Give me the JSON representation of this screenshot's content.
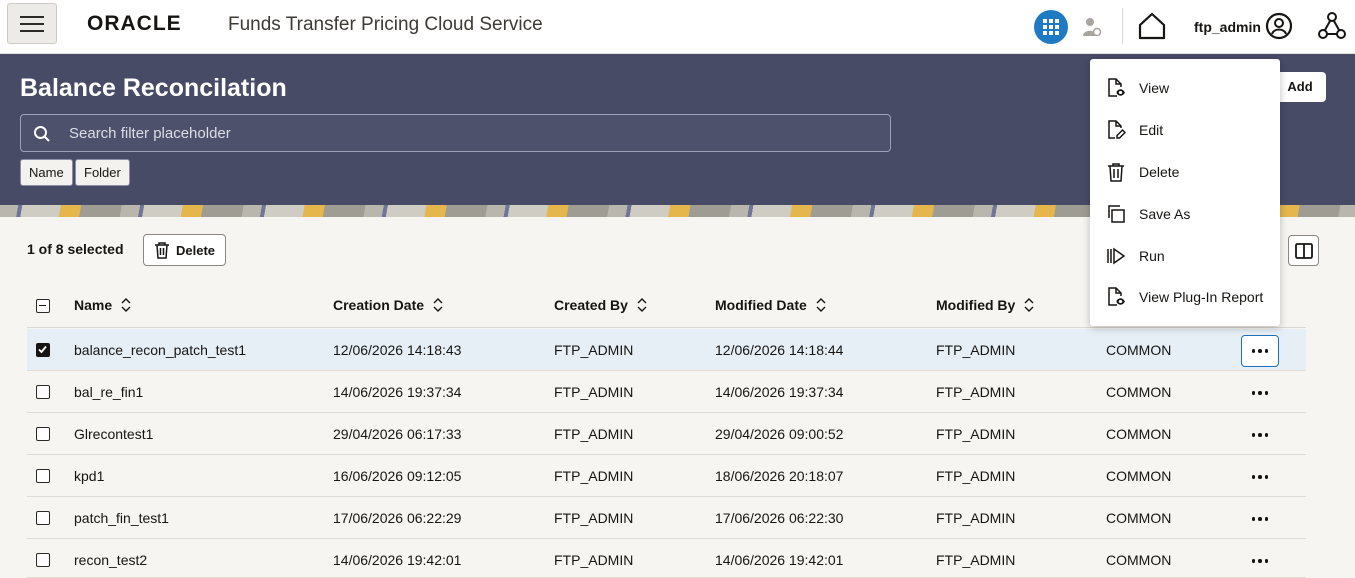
{
  "header": {
    "brand": "ORACLE",
    "app_title": "Funds Transfer Pricing Cloud Service",
    "user_name": "ftp_admin",
    "accent_color": "#1f7ac4"
  },
  "banner": {
    "title": "Balance Reconcilation",
    "search_placeholder": "Search filter placeholder",
    "filter_chips": [
      "Name",
      "Folder"
    ],
    "add_label": "Add"
  },
  "toolbar": {
    "selection_text": "1 of 8 selected",
    "delete_label": "Delete"
  },
  "table": {
    "columns": [
      "Name",
      "Creation Date",
      "Created By",
      "Modified Date",
      "Modified By"
    ],
    "rows": [
      {
        "name": "balance_recon_patch_test1",
        "created": "12/06/2026 14:18:43",
        "created_by": "FTP_ADMIN",
        "modified": "12/06/2026 14:18:44",
        "modified_by": "FTP_ADMIN",
        "folder": "COMMON",
        "selected": true
      },
      {
        "name": "bal_re_fin1",
        "created": "14/06/2026 19:37:34",
        "created_by": "FTP_ADMIN",
        "modified": "14/06/2026 19:37:34",
        "modified_by": "FTP_ADMIN",
        "folder": "COMMON",
        "selected": false
      },
      {
        "name": "Glrecontest1",
        "created": "29/04/2026 06:17:33",
        "created_by": "FTP_ADMIN",
        "modified": "29/04/2026 09:00:52",
        "modified_by": "FTP_ADMIN",
        "folder": "COMMON",
        "selected": false
      },
      {
        "name": "kpd1",
        "created": "16/06/2026 09:12:05",
        "created_by": "FTP_ADMIN",
        "modified": "18/06/2026 20:18:07",
        "modified_by": "FTP_ADMIN",
        "folder": "COMMON",
        "selected": false
      },
      {
        "name": "patch_fin_test1",
        "created": "17/06/2026 06:22:29",
        "created_by": "FTP_ADMIN",
        "modified": "17/06/2026 06:22:30",
        "modified_by": "FTP_ADMIN",
        "folder": "COMMON",
        "selected": false
      },
      {
        "name": "recon_test2",
        "created": "14/06/2026 19:42:01",
        "created_by": "FTP_ADMIN",
        "modified": "14/06/2026 19:42:01",
        "modified_by": "FTP_ADMIN",
        "folder": "COMMON",
        "selected": false
      }
    ]
  },
  "context_menu": {
    "items": [
      {
        "label": "View",
        "icon": "view-doc-icon"
      },
      {
        "label": "Edit",
        "icon": "edit-doc-icon"
      },
      {
        "label": "Delete",
        "icon": "trash-icon"
      },
      {
        "label": "Save As",
        "icon": "copy-icon"
      },
      {
        "label": "Run",
        "icon": "run-icon"
      },
      {
        "label": "View Plug-In Report",
        "icon": "report-doc-icon"
      }
    ]
  }
}
